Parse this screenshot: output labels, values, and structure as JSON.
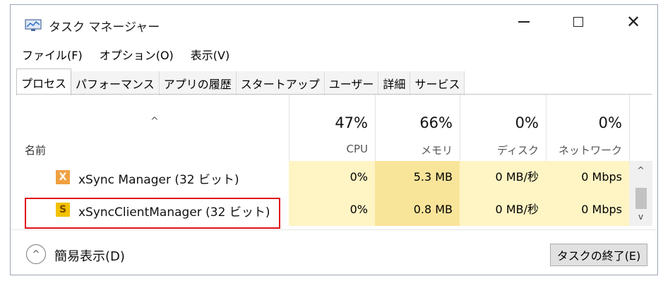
{
  "window": {
    "title": "タスク マネージャー",
    "icons": {
      "app": "task-manager-icon",
      "minimize": "minimize-icon",
      "maximize": "maximize-icon",
      "close": "close-icon"
    },
    "close_glyph": "✕"
  },
  "menu": [
    "ファイル(F)",
    "オプション(O)",
    "表示(V)"
  ],
  "tabs": [
    "プロセス",
    "パフォーマンス",
    "アプリの履歴",
    "スタートアップ",
    "ユーザー",
    "詳細",
    "サービス"
  ],
  "columns": {
    "name_label": "名前",
    "sort_glyph": "^",
    "cpu": {
      "pct": "47%",
      "label": "CPU"
    },
    "memory": {
      "pct": "66%",
      "label": "メモリ"
    },
    "disk": {
      "pct": "0%",
      "label": "ディスク"
    },
    "network": {
      "pct": "0%",
      "label": "ネットワーク"
    }
  },
  "processes": [
    {
      "name": "xSync Manager (32 ビット)",
      "icon_glyph": "X",
      "cpu": "0%",
      "memory": "5.3 MB",
      "disk": "0 MB/秒",
      "network": "0 Mbps"
    },
    {
      "name": "xSyncClientManager (32 ビット)",
      "icon_glyph": "S",
      "cpu": "0%",
      "memory": "0.8 MB",
      "disk": "0 MB/秒",
      "network": "0 Mbps"
    }
  ],
  "scroll": {
    "up": "^",
    "down": "v"
  },
  "footer": {
    "collapse_glyph": "^",
    "brief_label": "簡易表示(D)",
    "end_task_label": "タスクの終了(E)"
  },
  "colors": {
    "highlight": "#e0101a",
    "cell_light": "#fff4c4",
    "cell_medium": "#f9e59a"
  }
}
